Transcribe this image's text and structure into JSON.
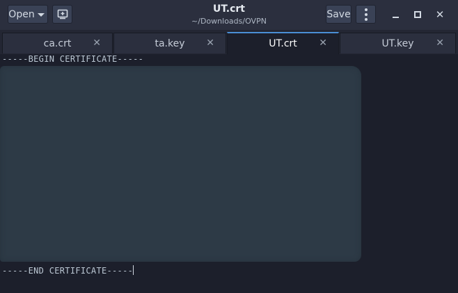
{
  "header": {
    "open_label": "Open",
    "save_label": "Save",
    "title": "UT.crt",
    "subtitle": "~/Downloads/OVPN",
    "close_glyph": "✕"
  },
  "tabs": [
    {
      "label": "ca.crt",
      "close": "✕",
      "active": false
    },
    {
      "label": "ta.key",
      "close": "✕",
      "active": false
    },
    {
      "label": "UT.crt",
      "close": "✕",
      "active": true
    },
    {
      "label": "UT.key",
      "close": "✕",
      "active": false
    }
  ],
  "editor": {
    "first_line": "-----BEGIN CERTIFICATE-----",
    "last_line": "-----END CERTIFICATE-----"
  },
  "colors": {
    "accent": "#4a8fd6",
    "redaction": "#2d3a46",
    "background": "#1c1f2b"
  }
}
